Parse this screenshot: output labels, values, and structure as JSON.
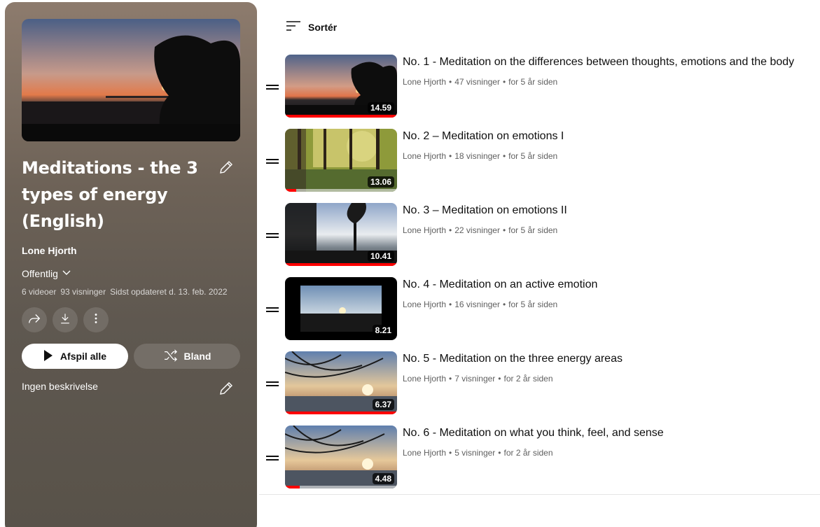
{
  "playlist": {
    "title": "Meditations - the 3 types of energy (English)",
    "owner": "Lone Hjorth",
    "privacy": "Offentlig",
    "stats": {
      "videos": "6 videoer",
      "views": "93 visninger",
      "updated": "Sidst opdateret d. 13. feb. 2022"
    },
    "play_all_label": "Afspil alle",
    "shuffle_label": "Bland",
    "description": "Ingen beskrivelse"
  },
  "sort_label": "Sortér",
  "videos": [
    {
      "title": "No. 1 - Meditation on the differences between thoughts, emotions and the body",
      "channel": "Lone Hjorth",
      "views": "47 visninger",
      "age": "for 5 år siden",
      "duration": "14.59",
      "progress": 1.0
    },
    {
      "title": "No. 2 – Meditation on emotions I",
      "channel": "Lone Hjorth",
      "views": "18 visninger",
      "age": "for 5 år siden",
      "duration": "13.06",
      "progress": 0.1
    },
    {
      "title": "No. 3 – Meditation on emotions II",
      "channel": "Lone Hjorth",
      "views": "22 visninger",
      "age": "for 5 år siden",
      "duration": "10.41",
      "progress": 1.0
    },
    {
      "title": "No. 4 - Meditation on an active emotion",
      "channel": "Lone Hjorth",
      "views": "16 visninger",
      "age": "for 5 år siden",
      "duration": "8.21",
      "progress": 0
    },
    {
      "title": "No. 5 - Meditation on the three energy areas",
      "channel": "Lone Hjorth",
      "views": "7 visninger",
      "age": "for 2 år siden",
      "duration": "6.37",
      "progress": 1.0
    },
    {
      "title": "No. 6 - Meditation on what you think, feel, and sense",
      "channel": "Lone Hjorth",
      "views": "5 visninger",
      "age": "for 2 år siden",
      "duration": "4.48",
      "progress": 0.13
    }
  ],
  "icons": {
    "edit": "pencil-icon",
    "privacy": "chevron-down-icon",
    "share": "share-icon",
    "download": "download-icon",
    "more": "more-vert-icon",
    "play": "play-icon",
    "shuffle": "shuffle-icon",
    "sort": "sort-icon",
    "drag": "drag-handle-icon"
  },
  "colors": {
    "progress": "#ff0000",
    "panel_bg": "#6d6257"
  }
}
